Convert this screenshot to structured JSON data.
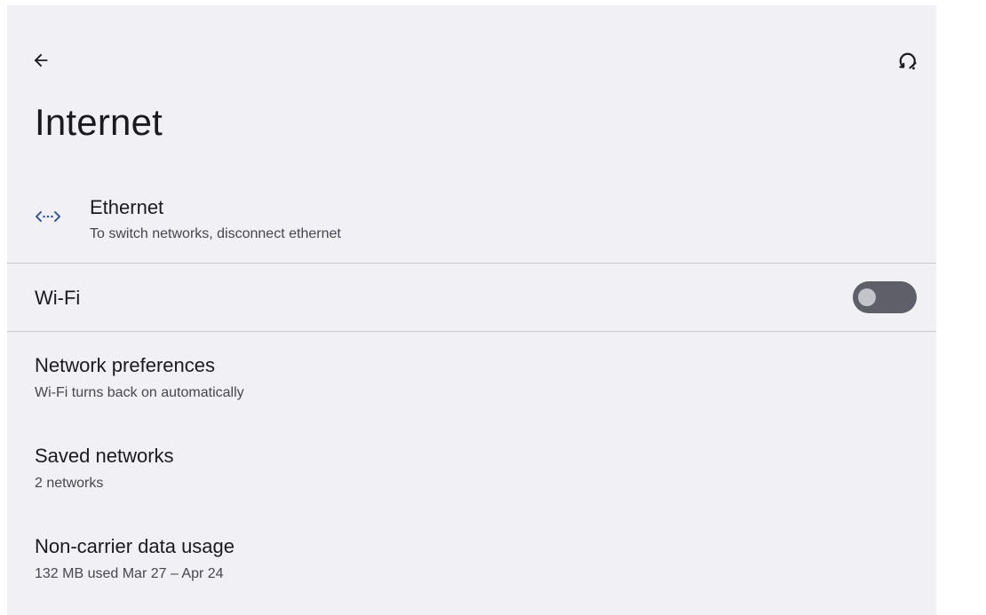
{
  "header": {
    "title": "Internet",
    "back_icon": "arrow-back-icon",
    "help_icon": "help-feedback-icon"
  },
  "ethernet": {
    "title": "Ethernet",
    "subtitle": "To switch networks, disconnect ethernet",
    "icon": "ethernet-icon",
    "icon_color": "#3b5a9a"
  },
  "wifi": {
    "title": "Wi-Fi",
    "enabled": false,
    "toggle_track_color": "#5f5f69",
    "toggle_knob_color": "#c3c3cc"
  },
  "settings": [
    {
      "title": "Network preferences",
      "subtitle": "Wi-Fi turns back on automatically"
    },
    {
      "title": "Saved networks",
      "subtitle": "2 networks"
    },
    {
      "title": "Non-carrier data usage",
      "subtitle": "132 MB used Mar 27 – Apr 24"
    }
  ],
  "colors": {
    "background": "#f1f0f4",
    "divider": "#c9c8cf",
    "text_primary": "#1b1b1f",
    "text_secondary": "#46464f"
  }
}
